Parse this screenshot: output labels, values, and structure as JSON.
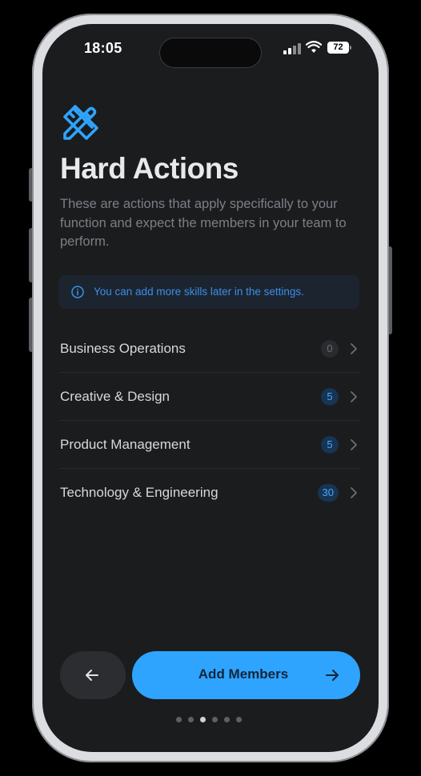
{
  "status_bar": {
    "time": "18:05",
    "battery": "72",
    "icons": [
      "signal-icon",
      "wifi-icon",
      "battery-icon"
    ]
  },
  "header": {
    "icon": "pencil-ruler-icon",
    "title": "Hard Actions",
    "description": "These are actions that apply specifically to your function and expect the members in your team to perform."
  },
  "info_banner": {
    "icon": "info-icon",
    "text": "You can add more skills later in the settings."
  },
  "skills": [
    {
      "label": "Business Operations",
      "count": "0"
    },
    {
      "label": "Creative & Design",
      "count": "5"
    },
    {
      "label": "Product Management",
      "count": "5"
    },
    {
      "label": "Technology & Engineering",
      "count": "30"
    }
  ],
  "footer": {
    "back_icon": "arrow-left-icon",
    "primary_label": "Add Members",
    "primary_icon": "arrow-right-icon",
    "pages_total": 6,
    "current_page": 3
  },
  "colors": {
    "accent": "#2ea4ff",
    "background": "#1b1c1e",
    "info_text": "#3b8fe6",
    "badge_active_bg": "#173452"
  }
}
